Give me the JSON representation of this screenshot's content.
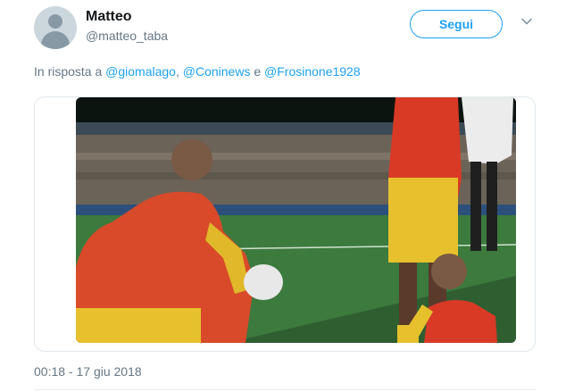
{
  "tweet": {
    "display_name": "Matteo",
    "handle": "@matteo_taba",
    "follow_label": "Segui",
    "reply": {
      "prefix": "In risposta a",
      "mentions": [
        "@giomalago",
        "@Coninews",
        "@Frosinone1928"
      ],
      "separator_comma": ",",
      "conjunction": "e"
    },
    "timestamp": "00:18 - 17 giu 2018"
  },
  "icons": {
    "avatar": "default-user-avatar",
    "more": "chevron-down-icon"
  },
  "colors": {
    "accent": "#1da1f2",
    "secondary_text": "#657786",
    "primary_text": "#14171a",
    "border": "#e1e8ed"
  }
}
